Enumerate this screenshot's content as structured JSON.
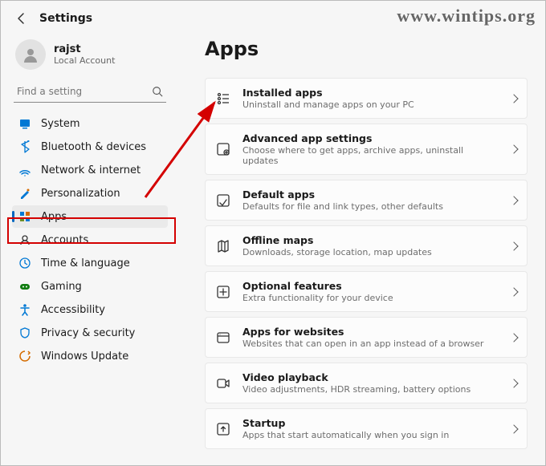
{
  "header": {
    "title": "Settings"
  },
  "watermark": "www.wintips.org",
  "user": {
    "name": "rajst",
    "sub": "Local Account"
  },
  "search": {
    "placeholder": "Find a setting"
  },
  "sidebar": {
    "items": [
      {
        "label": "System",
        "icon": "system"
      },
      {
        "label": "Bluetooth & devices",
        "icon": "bluetooth"
      },
      {
        "label": "Network & internet",
        "icon": "network"
      },
      {
        "label": "Personalization",
        "icon": "personalization"
      },
      {
        "label": "Apps",
        "icon": "apps",
        "selected": true
      },
      {
        "label": "Accounts",
        "icon": "accounts"
      },
      {
        "label": "Time & language",
        "icon": "time"
      },
      {
        "label": "Gaming",
        "icon": "gaming"
      },
      {
        "label": "Accessibility",
        "icon": "accessibility"
      },
      {
        "label": "Privacy & security",
        "icon": "privacy"
      },
      {
        "label": "Windows Update",
        "icon": "update"
      }
    ]
  },
  "page": {
    "title": "Apps"
  },
  "cards": [
    {
      "icon": "installed",
      "title": "Installed apps",
      "sub": "Uninstall and manage apps on your PC"
    },
    {
      "icon": "advanced",
      "title": "Advanced app settings",
      "sub": "Choose where to get apps, archive apps, uninstall updates"
    },
    {
      "icon": "default",
      "title": "Default apps",
      "sub": "Defaults for file and link types, other defaults"
    },
    {
      "icon": "maps",
      "title": "Offline maps",
      "sub": "Downloads, storage location, map updates"
    },
    {
      "icon": "optional",
      "title": "Optional features",
      "sub": "Extra functionality for your device"
    },
    {
      "icon": "websites",
      "title": "Apps for websites",
      "sub": "Websites that can open in an app instead of a browser"
    },
    {
      "icon": "video",
      "title": "Video playback",
      "sub": "Video adjustments, HDR streaming, battery options"
    },
    {
      "icon": "startup",
      "title": "Startup",
      "sub": "Apps that start automatically when you sign in"
    }
  ]
}
